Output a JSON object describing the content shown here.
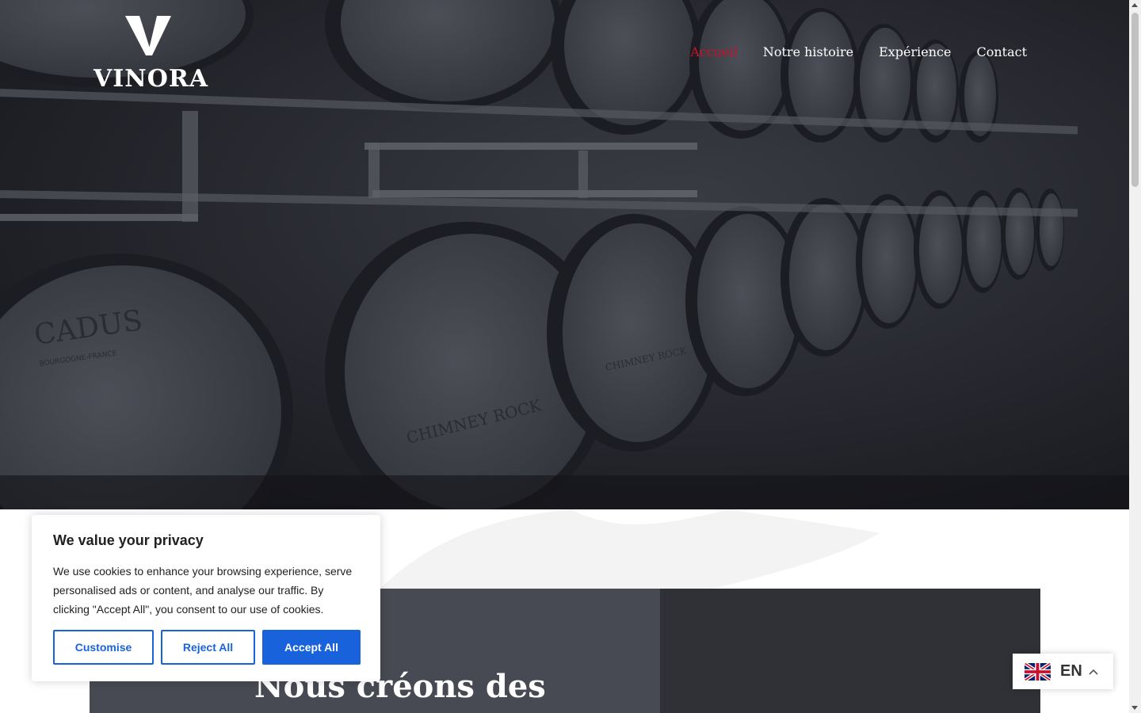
{
  "brand": {
    "logo_text": "VINORA"
  },
  "nav": {
    "items": [
      {
        "label": "Accueil",
        "active": true
      },
      {
        "label": "Notre histoire",
        "active": false
      },
      {
        "label": "Expérience",
        "active": false
      },
      {
        "label": "Contact",
        "active": false
      }
    ],
    "active_color": "#c8102e"
  },
  "hero": {
    "background_description_icon": "wine-barrels-photo",
    "barrel_labels": [
      "CADUS",
      "BOURGOGNE-FRANCE",
      "CHIMNEY ROCK",
      "CHIMNEY ROCK"
    ]
  },
  "section": {
    "heading": "Nous créons des"
  },
  "cookie": {
    "title": "We value your privacy",
    "text": "We use cookies to enhance your browsing experience, serve personalised ads or content, and analyse our traffic. By clicking \"Accept All\", you consent to our use of cookies.",
    "customise_label": "Customise",
    "reject_label": "Reject All",
    "accept_label": "Accept All",
    "accent_color": "#1863dc"
  },
  "language": {
    "code": "EN",
    "flag_icon": "uk-flag-icon",
    "chevron_icon": "chevron-up-icon"
  }
}
